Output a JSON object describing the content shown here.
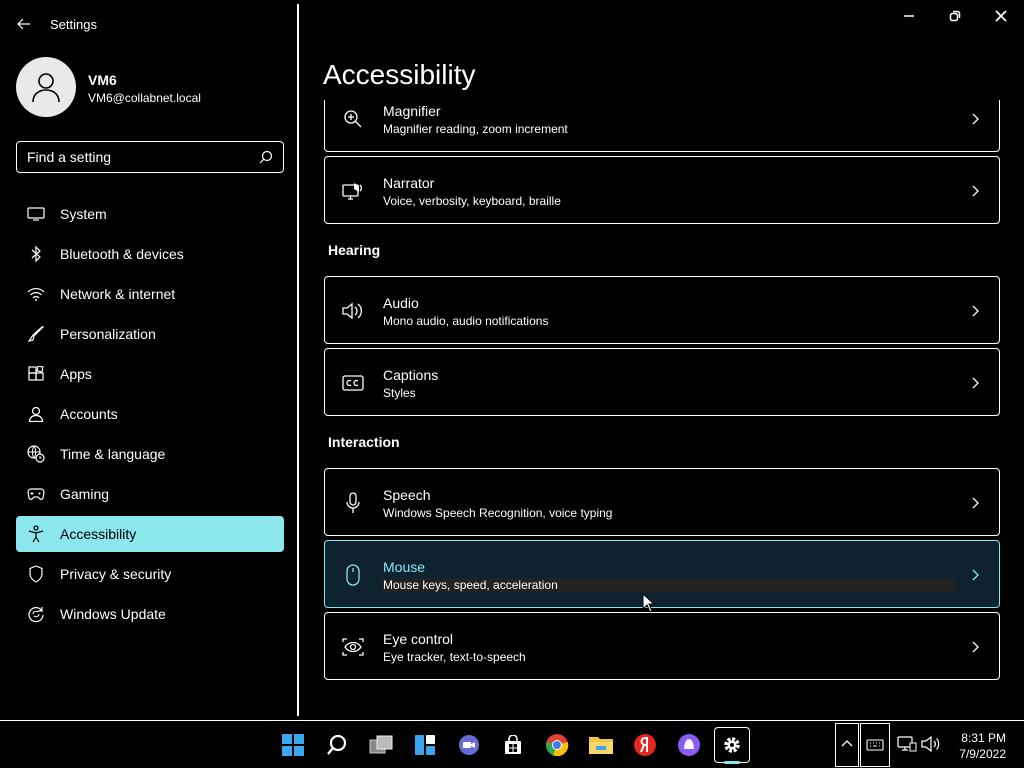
{
  "app": {
    "title": "Settings"
  },
  "user": {
    "name": "VM6",
    "email": "VM6@collabnet.local"
  },
  "search": {
    "placeholder": "Find a setting"
  },
  "sidebar": {
    "items": [
      {
        "label": "System",
        "icon": "monitor-icon"
      },
      {
        "label": "Bluetooth & devices",
        "icon": "bluetooth-icon"
      },
      {
        "label": "Network & internet",
        "icon": "wifi-icon"
      },
      {
        "label": "Personalization",
        "icon": "brush-icon"
      },
      {
        "label": "Apps",
        "icon": "apps-icon"
      },
      {
        "label": "Accounts",
        "icon": "person-icon"
      },
      {
        "label": "Time & language",
        "icon": "globe-clock-icon"
      },
      {
        "label": "Gaming",
        "icon": "gamepad-icon"
      },
      {
        "label": "Accessibility",
        "icon": "accessibility-icon",
        "active": true
      },
      {
        "label": "Privacy & security",
        "icon": "shield-icon"
      },
      {
        "label": "Windows Update",
        "icon": "update-icon"
      }
    ]
  },
  "main": {
    "title": "Accessibility",
    "cards": {
      "magnifier": {
        "title": "Magnifier",
        "sub": "Magnifier reading, zoom increment"
      },
      "narrator": {
        "title": "Narrator",
        "sub": "Voice, verbosity, keyboard, braille"
      },
      "audio": {
        "title": "Audio",
        "sub": "Mono audio, audio notifications"
      },
      "captions": {
        "title": "Captions",
        "sub": "Styles"
      },
      "speech": {
        "title": "Speech",
        "sub": "Windows Speech Recognition, voice typing"
      },
      "mouse": {
        "title": "Mouse",
        "sub": "Mouse keys, speed, acceleration"
      },
      "eye_control": {
        "title": "Eye control",
        "sub": "Eye tracker, text-to-speech"
      }
    },
    "sections": {
      "hearing": "Hearing",
      "interaction": "Interaction"
    }
  },
  "taskbar": {
    "time": "8:31 PM",
    "date": "7/9/2022",
    "colors": {
      "accent": "#8be6ee",
      "chrome": "#e34233",
      "yandex": "#e52620",
      "alice": "#8a5cf6",
      "folder": "#f4c542",
      "windows": "#3aa7f0"
    }
  }
}
